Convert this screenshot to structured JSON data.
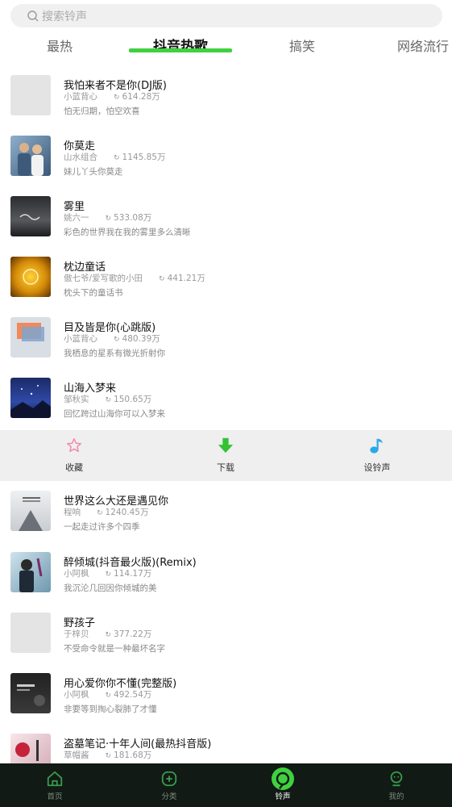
{
  "search": {
    "placeholder": "搜索铃声"
  },
  "tabs": [
    {
      "label": "最热"
    },
    {
      "label": "抖音热歌"
    },
    {
      "label": "搞笑"
    },
    {
      "label": "网络流行"
    }
  ],
  "songs": [
    {
      "title": "我怕来者不是你(DJ版)",
      "artist": "小蓝背心",
      "plays": "614.28万",
      "desc": "怕无归期，怕空欢喜"
    },
    {
      "title": "你莫走",
      "artist": "山水组合",
      "plays": "1145.85万",
      "desc": "妹儿丫头你莫走"
    },
    {
      "title": "雾里",
      "artist": "姚六一",
      "plays": "533.08万",
      "desc": "彩色的世界我在我的雾里多么清晰"
    },
    {
      "title": "枕边童话",
      "artist": "傲七爷/爱写歌的小田",
      "plays": "441.21万",
      "desc": "枕头下的童话书"
    },
    {
      "title": "目及皆是你(心跳版)",
      "artist": "小蓝背心",
      "plays": "480.39万",
      "desc": "我栖息的星系有微光折射你"
    },
    {
      "title": "山海入梦来",
      "artist": "邹秋实",
      "plays": "150.65万",
      "desc": "回忆跨过山海你可以入梦来"
    },
    {
      "title": "世界这么大还是遇见你",
      "artist": "程响",
      "plays": "1240.45万",
      "desc": "一起走过许多个四季"
    },
    {
      "title": "醉倾城(抖音最火版)(Remix)",
      "artist": "小阿枫",
      "plays": "114.17万",
      "desc": "我沉沦几回因你倾城的美"
    },
    {
      "title": "野孩子",
      "artist": "于梓贝",
      "plays": "377.22万",
      "desc": "不受命令就是一种最坏名字"
    },
    {
      "title": "用心爱你你不懂(完整版)",
      "artist": "小阿枫",
      "plays": "492.54万",
      "desc": "非要等到掏心裂肺了才懂"
    },
    {
      "title": "盗墓笔记·十年人间(最热抖音版)",
      "artist": "草帽酱",
      "plays": "181.68万",
      "desc": ""
    }
  ],
  "actions": {
    "favorite": "收藏",
    "download": "下载",
    "set_ringtone": "设铃声"
  },
  "nav": {
    "home": "首页",
    "category": "分类",
    "ringtone": "铃声",
    "mine": "我的"
  },
  "colors": {
    "accent": "#3fd13f",
    "nav_bg": "#111a14",
    "favorite": "#f08aa8",
    "download": "#34c234",
    "ringtone_note": "#29a9e8"
  }
}
